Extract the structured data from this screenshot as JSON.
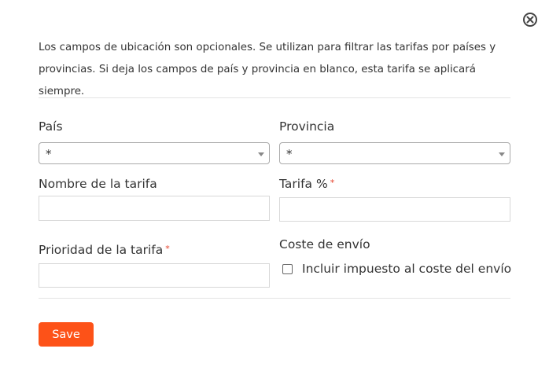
{
  "close_icon": "close-circle-icon",
  "intro": {
    "line1": "Los campos de ubicación son opcionales. Se utilizan para filtrar las tarifas por países y",
    "line2": "provincias. Si deja los campos de país y provincia en blanco, esta tarifa se aplicará siempre."
  },
  "form": {
    "pais": {
      "label": "País",
      "value": "*"
    },
    "provincia": {
      "label": "Provincia",
      "value": "*"
    },
    "nombre_tarifa": {
      "label": "Nombre de la tarifa",
      "value": ""
    },
    "tarifa_pct": {
      "label": "Tarifa %",
      "required_mark": "*",
      "value": ""
    },
    "prioridad": {
      "label": "Prioridad de la tarifa",
      "required_mark": "*",
      "value": ""
    },
    "coste_envio": {
      "label": "Coste de envío",
      "checkbox_label": "Incluir impuesto al coste del envío",
      "checked": false
    }
  },
  "save_label": "Save",
  "colors": {
    "accent": "#fd5218",
    "required": "#e5422c",
    "divider": "#e3e3e3"
  }
}
